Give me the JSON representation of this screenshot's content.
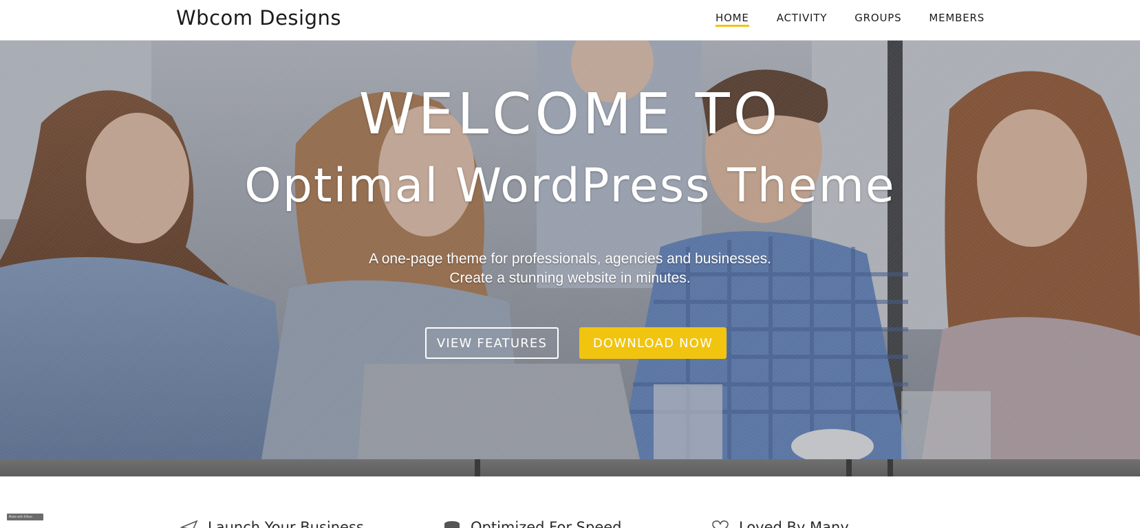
{
  "header": {
    "site_title": "Wbcom Designs",
    "nav": [
      {
        "label": "HOME",
        "active": true
      },
      {
        "label": "ACTIVITY",
        "active": false
      },
      {
        "label": "GROUPS",
        "active": false
      },
      {
        "label": "MEMBERS",
        "active": false
      }
    ]
  },
  "hero": {
    "heading_line1": "WELCOME TO",
    "heading_line2": "Optimal WordPress Theme",
    "subtitle_line1": "A one-page theme for professionals, agencies and businesses.",
    "subtitle_line2": "Create a stunning website in minutes.",
    "buttons": {
      "view_features": "VIEW FEATURES",
      "download_now": "DOWNLOAD NOW"
    }
  },
  "features": [
    {
      "icon": "paper-plane-icon",
      "label": "Launch Your Business"
    },
    {
      "icon": "database-icon",
      "label": "Optimized For Speed"
    },
    {
      "icon": "heart-icon",
      "label": "Loved By Many"
    }
  ],
  "badge": {
    "label": "Made with Elfsen"
  },
  "colors": {
    "accent": "#f1c40f",
    "header_bg": "#ffffff",
    "text_dark": "#1b1b1b"
  }
}
